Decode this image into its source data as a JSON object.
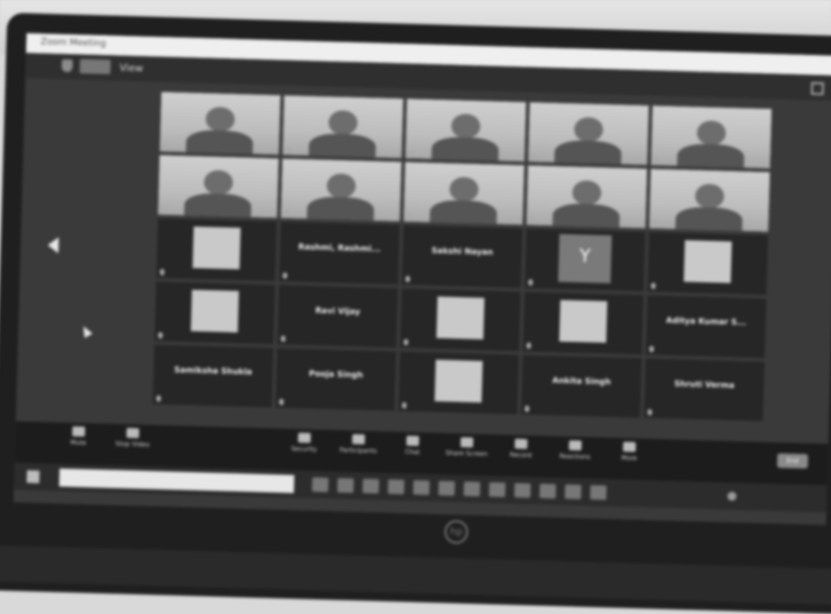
{
  "window": {
    "title": "Zoom Meeting"
  },
  "topbar": {
    "view_label": "View"
  },
  "tiles": [
    {
      "kind": "video",
      "label": "",
      "col": 0,
      "row": 0
    },
    {
      "kind": "video",
      "label": "",
      "col": 1,
      "row": 0
    },
    {
      "kind": "video",
      "label": "",
      "col": 2,
      "row": 0
    },
    {
      "kind": "video",
      "label": "",
      "col": 3,
      "row": 0
    },
    {
      "kind": "video",
      "label": "",
      "col": 4,
      "row": 0
    },
    {
      "kind": "video",
      "label": "",
      "col": 0,
      "row": 1
    },
    {
      "kind": "video",
      "label": "",
      "col": 1,
      "row": 1
    },
    {
      "kind": "video",
      "label": "",
      "col": 2,
      "row": 1
    },
    {
      "kind": "video",
      "label": "",
      "col": 3,
      "row": 1
    },
    {
      "kind": "video",
      "label": "",
      "col": 4,
      "row": 1
    },
    {
      "kind": "image",
      "label": "",
      "col": 0,
      "row": 2
    },
    {
      "kind": "name",
      "name": "Rashmi, Rashmi...",
      "label": "",
      "col": 1,
      "row": 2
    },
    {
      "kind": "name",
      "name": "Sakshi Nayan",
      "label": "",
      "col": 2,
      "row": 2
    },
    {
      "kind": "avatar",
      "avatar": "Y",
      "label": "",
      "col": 3,
      "row": 2
    },
    {
      "kind": "image",
      "label": "",
      "col": 4,
      "row": 2
    },
    {
      "kind": "image",
      "label": "",
      "col": 0,
      "row": 3
    },
    {
      "kind": "name",
      "name": "Ravi Vijay",
      "label": "",
      "col": 1,
      "row": 3
    },
    {
      "kind": "image",
      "label": "",
      "col": 2,
      "row": 3
    },
    {
      "kind": "image",
      "label": "",
      "col": 3,
      "row": 3
    },
    {
      "kind": "name",
      "name": "Aditya Kumar S...",
      "label": "",
      "col": 4,
      "row": 3
    },
    {
      "kind": "name",
      "name": "Samiksha Shukla",
      "label": "",
      "col": 0,
      "row": 4
    },
    {
      "kind": "name",
      "name": "Pooja Singh",
      "label": "",
      "col": 1,
      "row": 4
    },
    {
      "kind": "image",
      "label": "",
      "col": 2,
      "row": 4
    },
    {
      "kind": "name",
      "name": "Ankita Singh",
      "label": "",
      "col": 3,
      "row": 4
    },
    {
      "kind": "name",
      "name": "Shruti Verma",
      "label": "",
      "col": 4,
      "row": 4
    }
  ],
  "controls": [
    {
      "label": "Mute",
      "icon": "microphone-icon"
    },
    {
      "label": "Stop Video",
      "icon": "camera-icon"
    },
    {
      "label": "Security",
      "icon": "shield-icon"
    },
    {
      "label": "Participants",
      "icon": "people-icon"
    },
    {
      "label": "Chat",
      "icon": "chat-icon"
    },
    {
      "label": "Share Screen",
      "icon": "share-icon"
    },
    {
      "label": "Record",
      "icon": "record-icon"
    },
    {
      "label": "Reactions",
      "icon": "smiley-icon"
    },
    {
      "label": "More",
      "icon": "more-icon"
    }
  ],
  "controls_end_label": "End",
  "taskbar": {
    "apps": 12
  }
}
